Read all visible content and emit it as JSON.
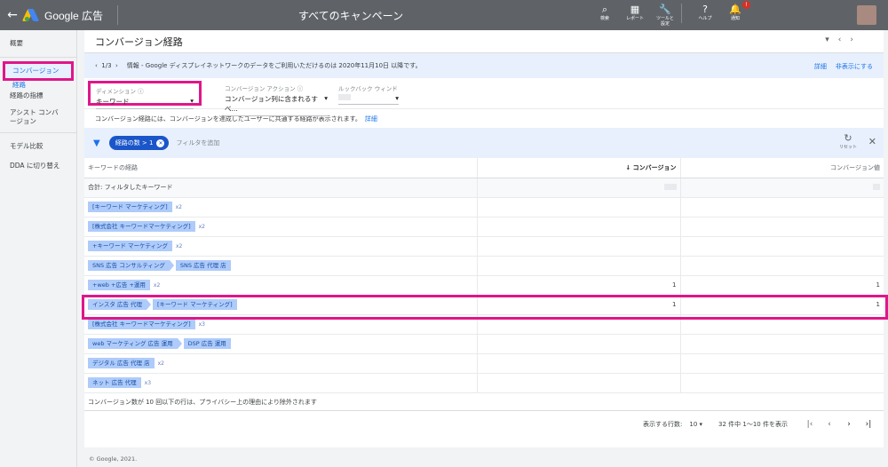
{
  "topbar": {
    "back_icon": "arrow-back-icon",
    "app_name": "Google 広告",
    "campaign": "すべてのキャンペーン",
    "icons": [
      {
        "name": "search-icon",
        "label": "検索",
        "glyph": "⌕"
      },
      {
        "name": "reports-icon",
        "label": "レポート",
        "glyph": "▦"
      },
      {
        "name": "tools-icon",
        "label": "ツールと設定",
        "glyph": "🔧"
      },
      {
        "name": "help-icon",
        "label": "ヘルプ",
        "glyph": "?"
      },
      {
        "name": "notifications-icon",
        "label": "通知",
        "glyph": "🔔"
      }
    ],
    "notif_count": "!"
  },
  "sidebar": {
    "items": [
      {
        "label": "概要"
      },
      {
        "label": "コンバージョン経路"
      },
      {
        "label": "経路の指標"
      },
      {
        "label": "アシスト コンバージョン"
      },
      {
        "label": "モデル比較"
      },
      {
        "label": "DDA に切り替え"
      }
    ]
  },
  "header": {
    "title": "コンバージョン経路",
    "dropdown": "▾",
    "prev": "‹",
    "next": "›"
  },
  "info": {
    "pager": "1/3",
    "text": "情報 - Google ディスプレイネットワークのデータをご利用いただけるのは 2020年11月10日 以降です。",
    "details": "詳細",
    "hide": "非表示にする"
  },
  "filters": {
    "dimension_label": "ディメンション",
    "dimension_value": "キーワード",
    "conversion_action_label": "コンバージョン アクション",
    "conversion_action_value": "コンバージョン列に含まれるすべ...",
    "lookback_label": "ルックバック ウィンド"
  },
  "description": {
    "text": "コンバージョン経路には、コンバージョンを達成したユーザーに共通する経路が表示されます。",
    "link": "詳細"
  },
  "filterbar": {
    "chip": "経路の数 > 1",
    "add": "フィルタを追加",
    "reset": "リセット"
  },
  "table": {
    "headers": [
      "キーワードの経路",
      "↓ コンバージョン",
      "コンバージョン値"
    ],
    "total_label": "合計: フィルタしたキーワード",
    "rows": [
      {
        "chips": [
          "[キーワード マーケティング]"
        ],
        "mult": "x2",
        "conv": "",
        "value": ""
      },
      {
        "chips": [
          "[株式会社 キーワードマーケティング]"
        ],
        "mult": "x2",
        "conv": "",
        "value": ""
      },
      {
        "chips": [
          "+キーワード マーケティング"
        ],
        "mult": "x2",
        "conv": "",
        "value": ""
      },
      {
        "chips": [
          "SNS 広告 コンサルティング",
          "SNS 広告 代理 店"
        ],
        "mult": "",
        "conv": "",
        "value": ""
      },
      {
        "chips": [
          "+web +広告 +運用"
        ],
        "mult": "x2",
        "conv": "1",
        "value": "1"
      },
      {
        "chips": [
          "インスタ 広告 代理",
          "[キーワード マーケティング]"
        ],
        "mult": "",
        "conv": "1",
        "value": "1"
      },
      {
        "chips": [
          "[株式会社 キーワードマーケティング]"
        ],
        "mult": "x3",
        "conv": "",
        "value": ""
      },
      {
        "chips": [
          "web マーケティング 広告 運用",
          "DSP 広告 運用"
        ],
        "mult": "",
        "conv": "",
        "value": ""
      },
      {
        "chips": [
          "デジタル 広告 代理 店"
        ],
        "mult": "x2",
        "conv": "",
        "value": ""
      },
      {
        "chips": [
          "ネット 広告 代理"
        ],
        "mult": "x3",
        "conv": "",
        "value": ""
      }
    ]
  },
  "footnote": "コンバージョン数が 10 回以下の行は、プライバシー上の理由により除外されます",
  "pager": {
    "rows_label": "表示する行数:",
    "rows_value": "10",
    "range": "32 件中 1～10 件を表示"
  },
  "copyright": "© Google, 2021."
}
